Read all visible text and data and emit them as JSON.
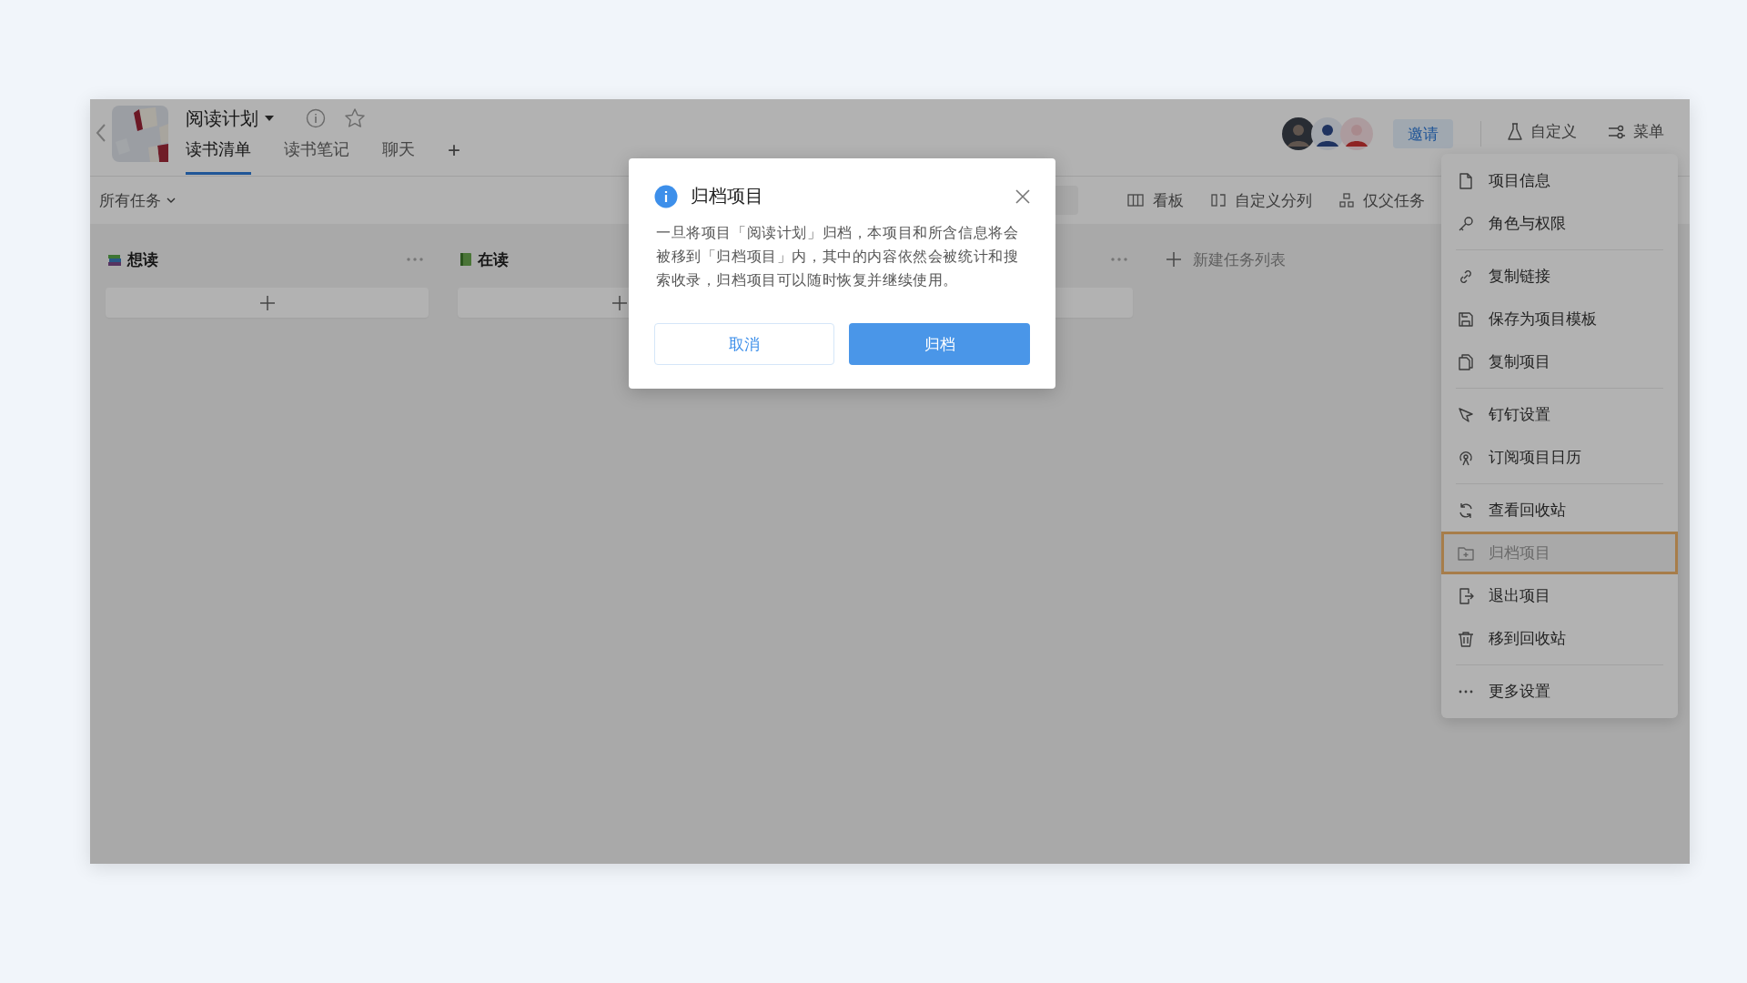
{
  "project": {
    "title": "阅读计划"
  },
  "tabs": [
    {
      "label": "读书清单",
      "selected": true
    },
    {
      "label": "读书笔记",
      "selected": false
    },
    {
      "label": "聊天",
      "selected": false
    }
  ],
  "add_tab": "+",
  "header_actions": {
    "invite": "邀请",
    "customize": "自定义",
    "menu": "菜单"
  },
  "filter": "所有任务",
  "view_options": [
    "看板",
    "自定义分列",
    "仅父任务"
  ],
  "columns": [
    {
      "title": "想读"
    },
    {
      "title": "在读"
    },
    {}
  ],
  "new_list": "新建任务列表",
  "menu": {
    "groups": [
      [
        {
          "label": "项目信息",
          "selected": false
        },
        {
          "label": "角色与权限",
          "selected": false
        }
      ],
      [
        {
          "label": "复制链接",
          "selected": false
        },
        {
          "label": "保存为项目模板",
          "selected": false
        },
        {
          "label": "复制项目",
          "selected": false
        }
      ],
      [
        {
          "label": "钉钉设置",
          "selected": false
        },
        {
          "label": "订阅项目日历",
          "selected": false
        }
      ],
      [
        {
          "label": "查看回收站",
          "selected": false
        },
        {
          "label": "归档项目",
          "selected": true
        },
        {
          "label": "退出项目",
          "selected": false
        },
        {
          "label": "移到回收站",
          "selected": false
        }
      ],
      [
        {
          "label": "更多设置",
          "selected": false
        }
      ]
    ]
  },
  "dialog": {
    "title": "归档项目",
    "body": "一旦将项目「阅读计划」归档，本项目和所含信息将会被移到「归档项目」内，其中的内容依然会被统计和搜索收录，归档项目可以随时恢复并继续使用。",
    "cancel": "取消",
    "confirm": "归档"
  }
}
